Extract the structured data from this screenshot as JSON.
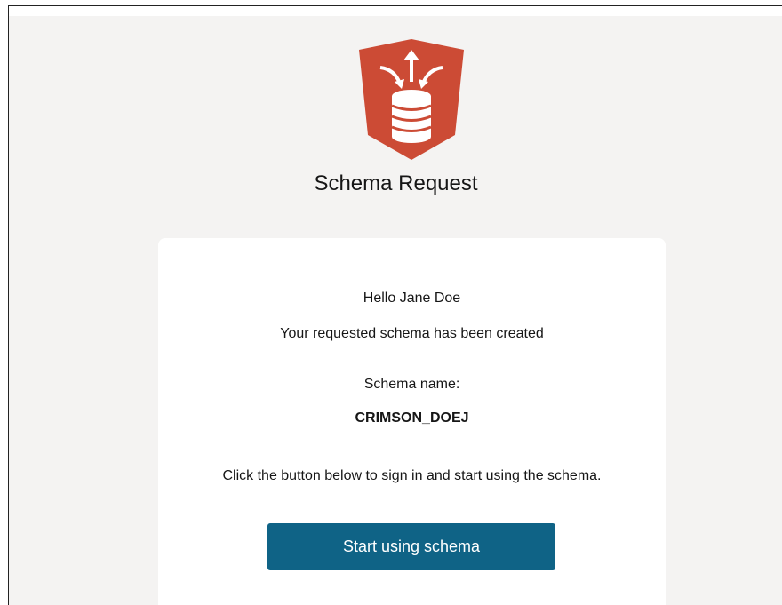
{
  "app": {
    "title": "Schema Request",
    "logo_icon": "database-merge-arrows-icon",
    "brand_color": "#cc4b35"
  },
  "email": {
    "greeting": "Hello Jane Doe",
    "status": "Your requested schema has been created",
    "schema_name_label": "Schema name:",
    "schema_name": "CRIMSON_DOEJ",
    "instructions": "Click the button below to sign in and start using the schema.",
    "cta_label": "Start using schema",
    "cta_color": "#0f6386"
  }
}
